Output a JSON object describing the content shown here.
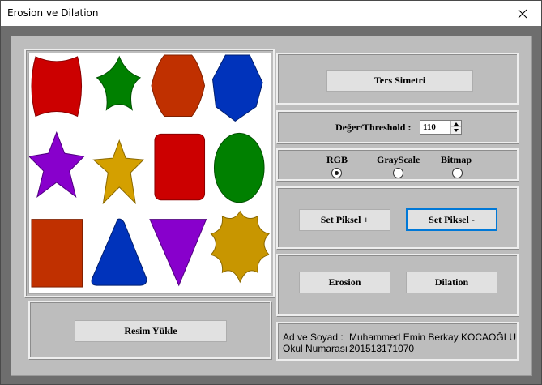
{
  "window": {
    "title": "Erosion ve Dilation"
  },
  "buttons": {
    "ters_simetri": "Ters Simetri",
    "set_piksel_plus": "Set Piksel +",
    "set_piksel_minus": "Set Piksel -",
    "erosion": "Erosion",
    "dilation": "Dilation",
    "resim_yukle": "Resim Yükle"
  },
  "threshold": {
    "label": "Değer/Threshold :",
    "value": "110"
  },
  "modes": {
    "options": [
      "RGB",
      "GrayScale",
      "Bitmap"
    ],
    "selected": "RGB"
  },
  "info": {
    "name_label": "Ad ve Soyad :",
    "name_value": "Muhammed Emin Berkay KOCAOĞLU",
    "number_label": "Okul Numarası :",
    "number_value": "201513171070"
  },
  "image": {
    "shapes": [
      {
        "kind": "wavy-square",
        "color": "#cc0000"
      },
      {
        "kind": "star-5-rounded",
        "color": "#008000"
      },
      {
        "kind": "octagon-rounded",
        "color": "#c03000"
      },
      {
        "kind": "heptagon",
        "color": "#0033bb"
      },
      {
        "kind": "star-6",
        "color": "#8800cc"
      },
      {
        "kind": "star-5",
        "color": "#d4a000"
      },
      {
        "kind": "rounded-rectangle",
        "color": "#cc0000"
      },
      {
        "kind": "ellipse",
        "color": "#008000"
      },
      {
        "kind": "rectangle",
        "color": "#c03000"
      },
      {
        "kind": "triangle-up",
        "color": "#0033bb"
      },
      {
        "kind": "triangle-down",
        "color": "#8800cc"
      },
      {
        "kind": "star-8-wavy",
        "color": "#c89600"
      }
    ]
  }
}
